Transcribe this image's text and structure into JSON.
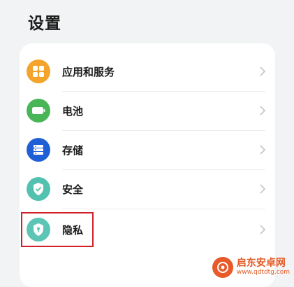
{
  "header": {
    "title": "设置"
  },
  "settings": {
    "items": [
      {
        "label": "应用和服务",
        "icon": "apps-icon",
        "color": "#f4a42a"
      },
      {
        "label": "电池",
        "icon": "battery-icon",
        "color": "#48b657"
      },
      {
        "label": "存储",
        "icon": "storage-icon",
        "color": "#1f5fd6"
      },
      {
        "label": "安全",
        "icon": "shield-check-icon",
        "color": "#52c1b0"
      },
      {
        "label": "隐私",
        "icon": "privacy-shield-icon",
        "color": "#5cc5b6"
      }
    ]
  },
  "watermark": {
    "name": "启东安卓网",
    "url": "www.qdtdtg.com"
  },
  "colors": {
    "highlight": "#d0212b",
    "background": "#f1f3f5"
  }
}
